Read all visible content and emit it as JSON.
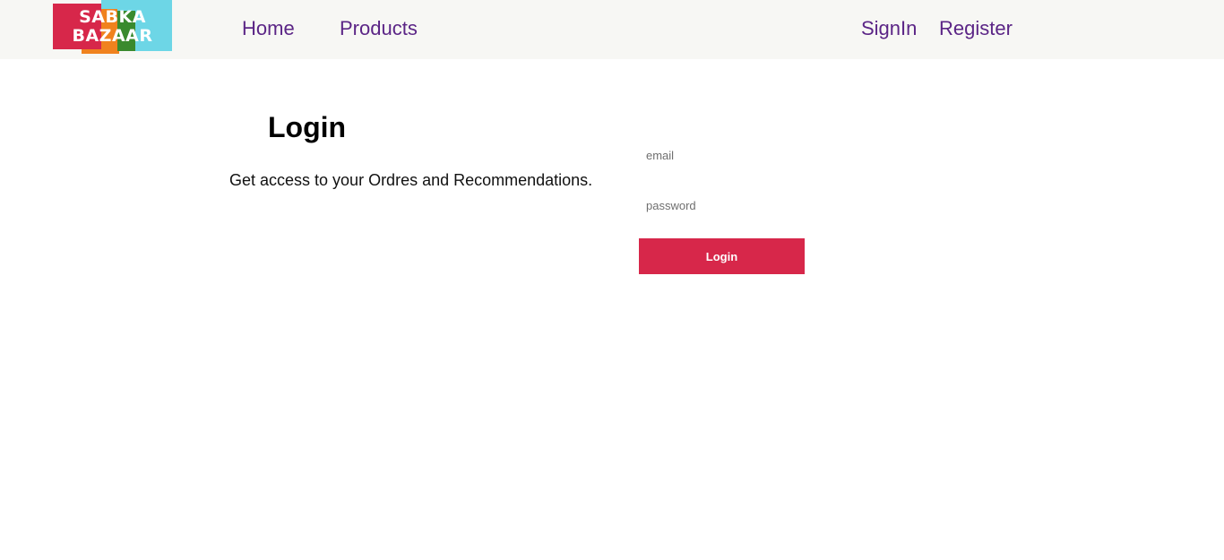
{
  "header": {
    "logo": {
      "line1": "SABKA",
      "line2": "BAZAAR",
      "colors": [
        "#d7274a",
        "#f0821e",
        "#3a8a2e",
        "#6dd6e6"
      ]
    },
    "nav_left": [
      {
        "label": "Home"
      },
      {
        "label": "Products"
      }
    ],
    "nav_right": [
      {
        "label": "SignIn"
      },
      {
        "label": "Register"
      }
    ],
    "link_color": "#5b2586",
    "background": "#f7f7f4"
  },
  "login": {
    "title": "Login",
    "subtitle": "Get access to your Ordres and Recommendations.",
    "email": {
      "placeholder": "email",
      "value": ""
    },
    "password": {
      "placeholder": "password",
      "value": ""
    },
    "submit_label": "Login",
    "accent_color": "#d7274a"
  }
}
